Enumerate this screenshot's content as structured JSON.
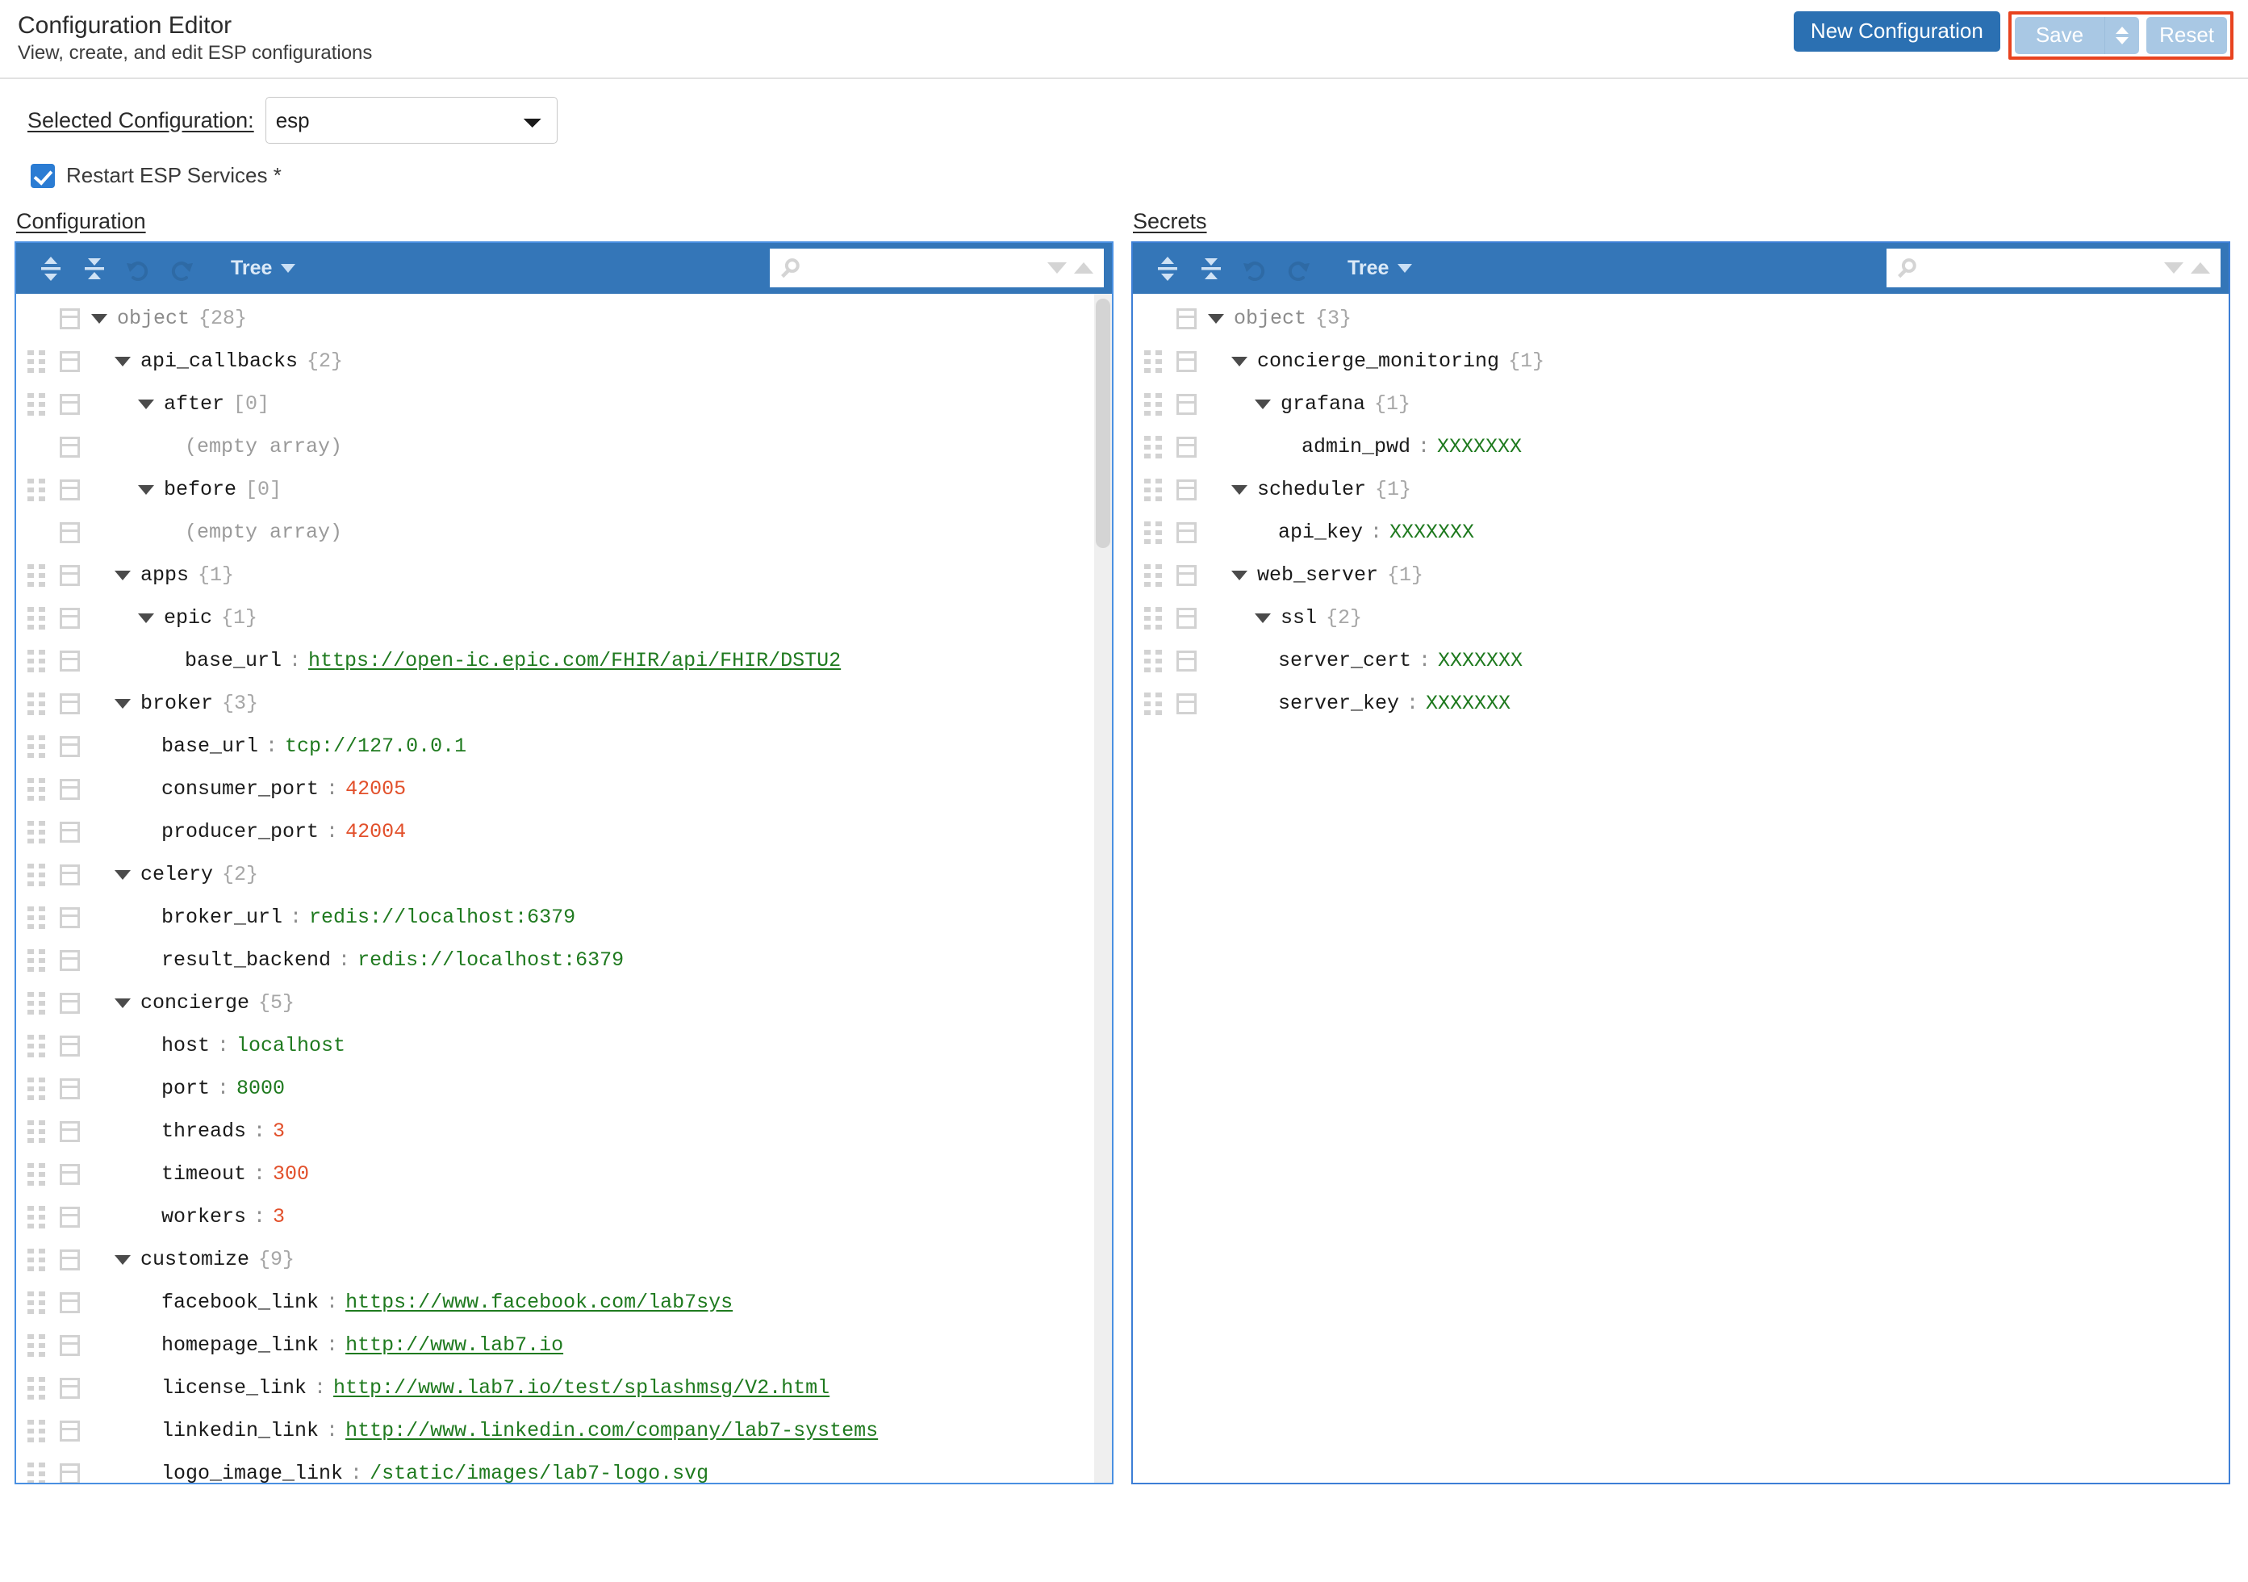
{
  "header": {
    "title": "Configuration Editor",
    "subtitle": "View, create, and edit ESP configurations",
    "new_config_label": "New Configuration",
    "save_label": "Save",
    "reset_label": "Reset"
  },
  "selected_configuration": {
    "label": "Selected Configuration:",
    "value": "esp",
    "options": [
      "esp"
    ]
  },
  "restart": {
    "label": "Restart ESP Services *",
    "checked": true
  },
  "colors": {
    "accent_blue": "#2b70b2",
    "toolbar_blue": "#3476b8",
    "panel_border": "#4a90e2",
    "highlight_red": "#e8431f",
    "disabled_button": "#a9c8e4",
    "string_green": "#1f7a1f",
    "number_orange": "#e2502b",
    "muted_gray": "#a6a6a6"
  },
  "editors": [
    {
      "title": "Configuration",
      "toolbar": {
        "expand_all_icon": "expand-all-icon",
        "collapse_all_icon": "collapse-all-icon",
        "undo_icon": "undo-icon",
        "redo_icon": "redo-icon",
        "mode_label": "Tree",
        "search_placeholder": "",
        "search_value": "",
        "search_icon": "search-icon",
        "next_icon": "search-next-icon",
        "prev_icon": "search-previous-icon"
      },
      "scrollbar": {
        "visible": true,
        "thumb_fraction": 0.21
      },
      "rows": [
        {
          "indent": 0,
          "expander": "down",
          "drag": false,
          "key": "object",
          "key_style": "root",
          "count": "{28}"
        },
        {
          "indent": 1,
          "expander": "down",
          "drag": true,
          "key": "api_callbacks",
          "count": "{2}"
        },
        {
          "indent": 2,
          "expander": "down",
          "drag": true,
          "key": "after",
          "count": "[0]"
        },
        {
          "indent": 4,
          "expander": "none",
          "drag": false,
          "key": "",
          "empty": "(empty array)"
        },
        {
          "indent": 2,
          "expander": "down",
          "drag": true,
          "key": "before",
          "count": "[0]"
        },
        {
          "indent": 4,
          "expander": "none",
          "drag": false,
          "key": "",
          "empty": "(empty array)"
        },
        {
          "indent": 1,
          "expander": "down",
          "drag": true,
          "key": "apps",
          "count": "{1}"
        },
        {
          "indent": 2,
          "expander": "down",
          "drag": true,
          "key": "epic",
          "count": "{1}"
        },
        {
          "indent": 4,
          "expander": "none",
          "drag": true,
          "key": "base_url",
          "value": "https://open-ic.epic.com/FHIR/api/FHIR/DSTU2",
          "type": "link"
        },
        {
          "indent": 1,
          "expander": "down",
          "drag": true,
          "key": "broker",
          "count": "{3}"
        },
        {
          "indent": 3,
          "expander": "none",
          "drag": true,
          "key": "base_url",
          "value": "tcp://127.0.0.1",
          "type": "string"
        },
        {
          "indent": 3,
          "expander": "none",
          "drag": true,
          "key": "consumer_port",
          "value": "42005",
          "type": "number"
        },
        {
          "indent": 3,
          "expander": "none",
          "drag": true,
          "key": "producer_port",
          "value": "42004",
          "type": "number"
        },
        {
          "indent": 1,
          "expander": "down",
          "drag": true,
          "key": "celery",
          "count": "{2}"
        },
        {
          "indent": 3,
          "expander": "none",
          "drag": true,
          "key": "broker_url",
          "value": "redis://localhost:6379",
          "type": "string"
        },
        {
          "indent": 3,
          "expander": "none",
          "drag": true,
          "key": "result_backend",
          "value": "redis://localhost:6379",
          "type": "string"
        },
        {
          "indent": 1,
          "expander": "down",
          "drag": true,
          "key": "concierge",
          "count": "{5}"
        },
        {
          "indent": 3,
          "expander": "none",
          "drag": true,
          "key": "host",
          "value": "localhost",
          "type": "string"
        },
        {
          "indent": 3,
          "expander": "none",
          "drag": true,
          "key": "port",
          "value": "8000",
          "type": "string"
        },
        {
          "indent": 3,
          "expander": "none",
          "drag": true,
          "key": "threads",
          "value": "3",
          "type": "number"
        },
        {
          "indent": 3,
          "expander": "none",
          "drag": true,
          "key": "timeout",
          "value": "300",
          "type": "number"
        },
        {
          "indent": 3,
          "expander": "none",
          "drag": true,
          "key": "workers",
          "value": "3",
          "type": "number"
        },
        {
          "indent": 1,
          "expander": "down",
          "drag": true,
          "key": "customize",
          "count": "{9}"
        },
        {
          "indent": 3,
          "expander": "none",
          "drag": true,
          "key": "facebook_link",
          "value": "https://www.facebook.com/lab7sys",
          "type": "link"
        },
        {
          "indent": 3,
          "expander": "none",
          "drag": true,
          "key": "homepage_link",
          "value": "http://www.lab7.io",
          "type": "link"
        },
        {
          "indent": 3,
          "expander": "none",
          "drag": true,
          "key": "license_link",
          "value": "http://www.lab7.io/test/splashmsg/V2.html",
          "type": "link"
        },
        {
          "indent": 3,
          "expander": "none",
          "drag": true,
          "key": "linkedin_link",
          "value": "http://www.linkedin.com/company/lab7-systems",
          "type": "link"
        },
        {
          "indent": 3,
          "expander": "none",
          "drag": true,
          "key": "logo_image_link",
          "value": "/static/images/lab7-logo.svg",
          "type": "string"
        }
      ]
    },
    {
      "title": "Secrets",
      "toolbar": {
        "expand_all_icon": "expand-all-icon",
        "collapse_all_icon": "collapse-all-icon",
        "undo_icon": "undo-icon",
        "redo_icon": "redo-icon",
        "mode_label": "Tree",
        "search_placeholder": "",
        "search_value": "",
        "search_icon": "search-icon",
        "next_icon": "search-next-icon",
        "prev_icon": "search-previous-icon"
      },
      "scrollbar": {
        "visible": false,
        "thumb_fraction": 1
      },
      "rows": [
        {
          "indent": 0,
          "expander": "down",
          "drag": false,
          "key": "object",
          "key_style": "root",
          "count": "{3}"
        },
        {
          "indent": 1,
          "expander": "down",
          "drag": true,
          "key": "concierge_monitoring",
          "count": "{1}"
        },
        {
          "indent": 2,
          "expander": "down",
          "drag": true,
          "key": "grafana",
          "count": "{1}"
        },
        {
          "indent": 4,
          "expander": "none",
          "drag": true,
          "key": "admin_pwd",
          "value": "XXXXXXX",
          "type": "string"
        },
        {
          "indent": 1,
          "expander": "down",
          "drag": true,
          "key": "scheduler",
          "count": "{1}"
        },
        {
          "indent": 3,
          "expander": "none",
          "drag": true,
          "key": "api_key",
          "value": "XXXXXXX",
          "type": "string"
        },
        {
          "indent": 1,
          "expander": "down",
          "drag": true,
          "key": "web_server",
          "count": "{1}"
        },
        {
          "indent": 2,
          "expander": "down",
          "drag": true,
          "key": "ssl",
          "count": "{2}"
        },
        {
          "indent": 3,
          "expander": "none",
          "drag": true,
          "key": "server_cert",
          "value": "XXXXXXX",
          "type": "string"
        },
        {
          "indent": 3,
          "expander": "none",
          "drag": true,
          "key": "server_key",
          "value": "XXXXXXX",
          "type": "string"
        }
      ]
    }
  ]
}
